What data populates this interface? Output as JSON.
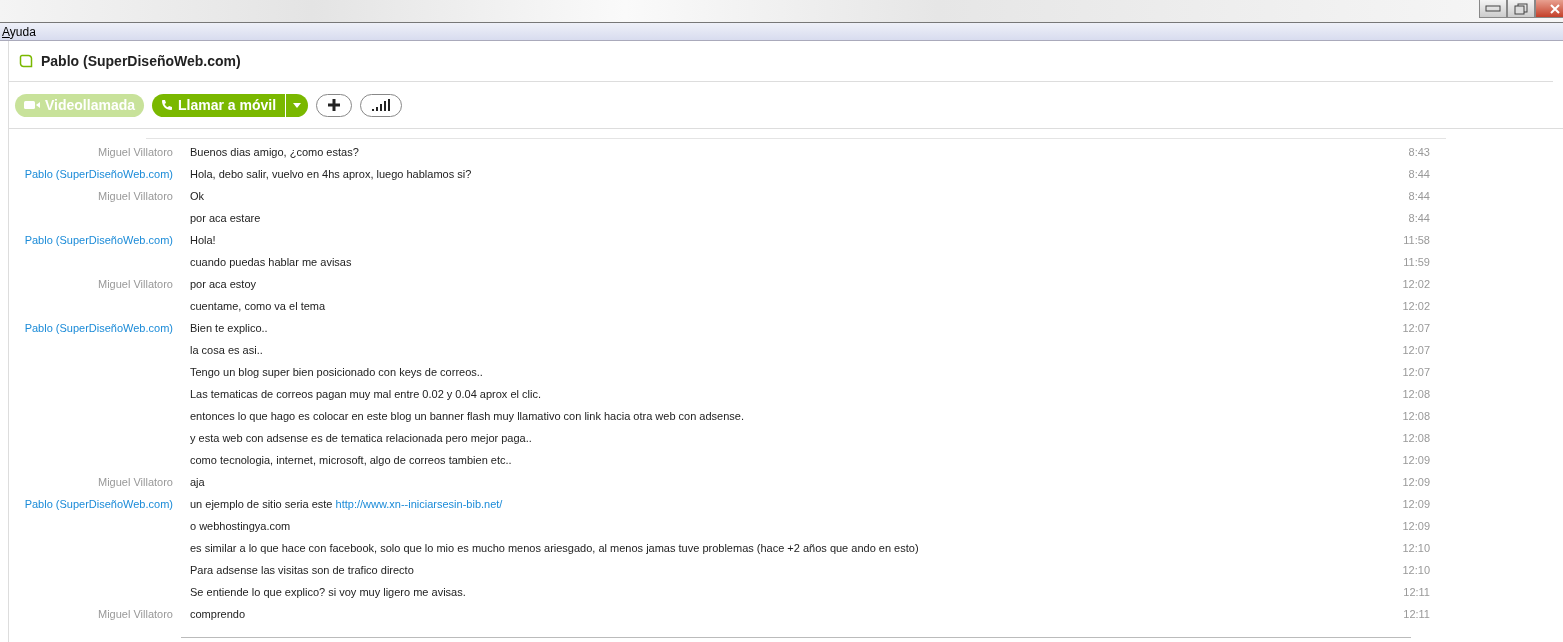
{
  "menu": [
    "Ayuda"
  ],
  "contact": {
    "name": "Pablo (SuperDiseñoWeb.com)"
  },
  "toolbar": {
    "video_button": {
      "label": "Videollamada",
      "disabled": true
    },
    "call_button": {
      "label": "Llamar a móvil"
    }
  },
  "messages": [
    {
      "sender": "Miguel Villatoro",
      "kind": "self",
      "text": "Buenos dias amigo, ¿como estas?",
      "time": "8:43"
    },
    {
      "sender": "Pablo (SuperDiseñoWeb.com)",
      "kind": "contact",
      "text": "Hola, debo salir, vuelvo en 4hs aprox, luego hablamos si?",
      "time": "8:44"
    },
    {
      "sender": "Miguel Villatoro",
      "kind": "self",
      "text": "Ok",
      "time": "8:44"
    },
    {
      "text": "por aca estare",
      "time": "8:44"
    },
    {
      "sender": "Pablo (SuperDiseñoWeb.com)",
      "kind": "contact",
      "text": "Hola!",
      "time": "11:58"
    },
    {
      "text": "cuando puedas hablar me avisas",
      "time": "11:59"
    },
    {
      "sender": "Miguel Villatoro",
      "kind": "self",
      "text": "por aca estoy",
      "time": "12:02"
    },
    {
      "text": "cuentame, como va el tema",
      "time": "12:02"
    },
    {
      "sender": "Pablo (SuperDiseñoWeb.com)",
      "kind": "contact",
      "text": "Bien te explico..",
      "time": "12:07"
    },
    {
      "text": "la cosa es asi..",
      "time": "12:07"
    },
    {
      "text": "Tengo un blog super bien posicionado con keys de correos..",
      "time": "12:07"
    },
    {
      "text": "Las tematicas de correos pagan muy mal entre 0.02 y 0.04 aprox el clic.",
      "time": "12:08"
    },
    {
      "text": "entonces lo que hago es colocar en este blog un banner flash muy llamativo con link hacia otra web con adsense.",
      "time": "12:08"
    },
    {
      "text": "y esta web con adsense es de tematica relacionada pero mejor paga..",
      "time": "12:08"
    },
    {
      "text": "como tecnologia, internet, microsoft, algo de correos tambien etc..",
      "time": "12:09"
    },
    {
      "sender": "Miguel Villatoro",
      "kind": "self",
      "text": "aja",
      "time": "12:09"
    },
    {
      "sender": "Pablo (SuperDiseñoWeb.com)",
      "kind": "contact",
      "text": "un ejemplo de sitio seria este",
      "link": "http://www.xn--iniciarsesin-bib.net/",
      "time": "12:09"
    },
    {
      "text": "o webhostingya.com",
      "time": "12:09"
    },
    {
      "text": "es similar a lo que hace con facebook, solo que lo mio es mucho menos ariesgado, al menos jamas tuve problemas (hace +2 años que ando en esto)",
      "time": "12:10"
    },
    {
      "text": "Para adsense las visitas son de trafico directo",
      "time": "12:10"
    },
    {
      "text": "Se entiende lo que explico? si voy muy ligero me avisas.",
      "time": "12:11"
    },
    {
      "sender": "Miguel Villatoro",
      "kind": "self",
      "text": "comprendo",
      "time": "12:11"
    }
  ]
}
